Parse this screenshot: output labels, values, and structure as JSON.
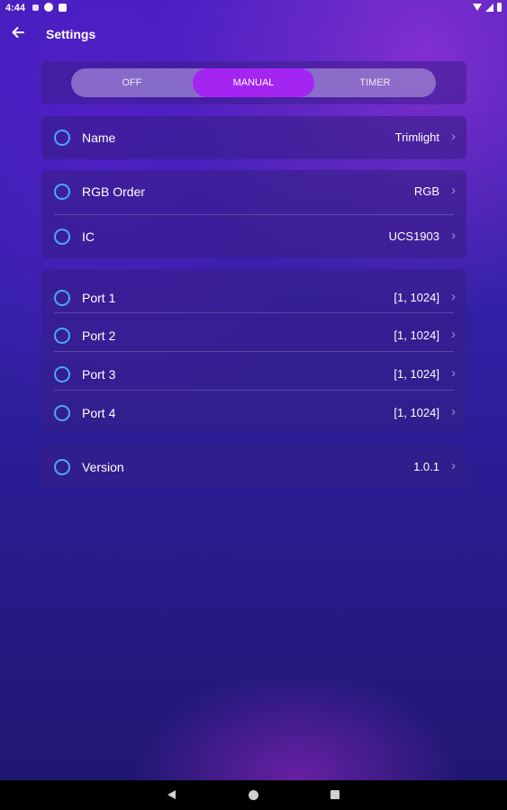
{
  "status_bar": {
    "time": "4:44",
    "icons_left": [
      "pinwheel-icon",
      "parking-icon",
      "sim-card-icon"
    ],
    "icons_right": [
      "wifi-icon",
      "signal-icon",
      "battery-icon"
    ]
  },
  "app_bar": {
    "back_icon": "arrow-left-icon",
    "title": "Settings"
  },
  "mode_selector": {
    "options": [
      "OFF",
      "MANUAL",
      "TIMER"
    ],
    "selected": "MANUAL",
    "accent_color": "#a424f2"
  },
  "groups": [
    {
      "rows": [
        {
          "label": "Name",
          "value": "Trimlight"
        }
      ]
    },
    {
      "rows": [
        {
          "label": "RGB Order",
          "value": "RGB"
        },
        {
          "label": "IC",
          "value": "UCS1903"
        }
      ]
    },
    {
      "rows": [
        {
          "label": "Port 1",
          "value": "[1, 1024]"
        },
        {
          "label": "Port 2",
          "value": "[1, 1024]"
        },
        {
          "label": "Port 3",
          "value": "[1, 1024]"
        },
        {
          "label": "Port 4",
          "value": "[1, 1024]"
        }
      ]
    },
    {
      "rows": [
        {
          "label": "Version",
          "value": "1.0.1"
        }
      ]
    }
  ],
  "row_icon": "circle-ring-icon",
  "row_icon_color": "#4aa8ff",
  "chevron_icon": "chevron-right-icon",
  "chevron_glyph": "›",
  "nav_bar": {
    "icons": [
      "nav-back-icon",
      "nav-home-icon",
      "nav-recents-icon"
    ]
  }
}
